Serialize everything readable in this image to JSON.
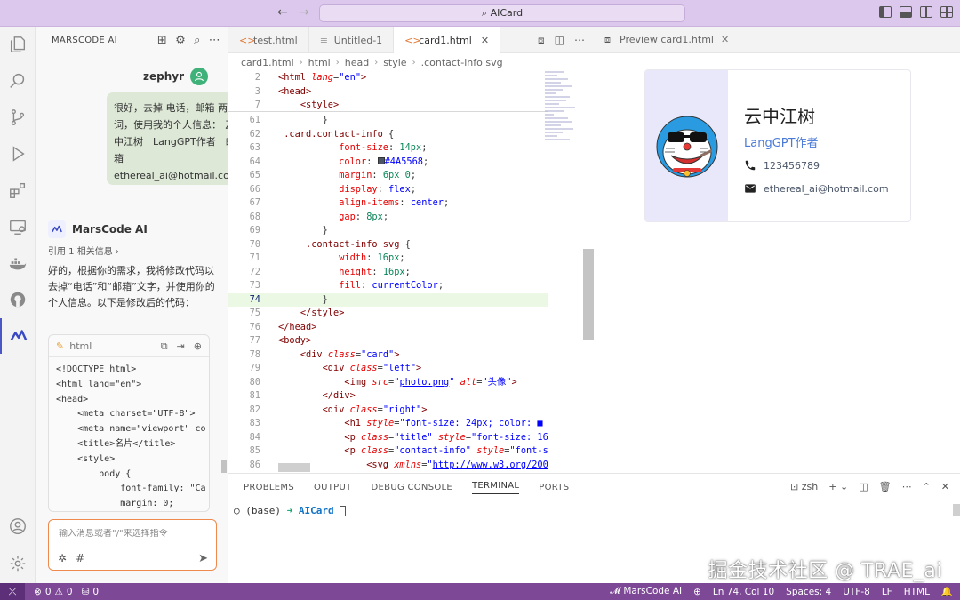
{
  "titlebar": {
    "back": "←",
    "forward": "→",
    "search_text": "AICard"
  },
  "sidepanel": {
    "title": "MARSCODE AI",
    "user_name": "zephyr",
    "user_message": "很好，去掉 电话，邮箱 两个词，使用我的个人信息： 云中江树　LangGPT作者　邮箱 ethereal_ai@hotmail.com",
    "ai_name": "MarsCode AI",
    "reference": "引用 1 相关信息 ›",
    "ai_reply": "好的，根据你的需求，我将修改代码以去掉“电话”和“邮箱”文字，并使用你的个人信息。以下是修改后的代码：",
    "code_lang": "html",
    "code_snippet": "<!DOCTYPE html>\n<html lang=\"en\">\n<head>\n    <meta charset=\"UTF-8\">\n    <meta name=\"viewport\" co\n    <title>名片</title>\n    <style>\n        body {\n            font-family: \"Ca\n            margin: 0;",
    "input_placeholder": "输入消息或者\"/\"来选择指令"
  },
  "editor": {
    "tabs": [
      {
        "label": "test.html",
        "active": false
      },
      {
        "label": "Untitled-1",
        "active": false
      },
      {
        "label": "card1.html",
        "active": true
      }
    ],
    "breadcrumb": [
      "card1.html",
      "html",
      "head",
      "style",
      ".contact-info svg"
    ],
    "current_line": 74
  },
  "preview": {
    "tab_label": "Preview card1.html",
    "name": "云中江树",
    "title": "LangGPT作者",
    "phone": "123456789",
    "email": "ethereal_ai@hotmail.com"
  },
  "bottompanel": {
    "tabs": [
      "PROBLEMS",
      "OUTPUT",
      "DEBUG CONSOLE",
      "TERMINAL",
      "PORTS"
    ],
    "active_tab": "TERMINAL",
    "shell": "zsh",
    "prompt_env": "(base)",
    "prompt_arrow": "➜",
    "prompt_dir": "AICard",
    "watermark": "掘金技术社区 @ TRAE_ai"
  },
  "statusbar": {
    "errors": "0",
    "warnings": "0",
    "ports": "0",
    "marscode": "MarsCode AI",
    "position": "Ln 74, Col 10",
    "spaces": "Spaces: 4",
    "encoding": "UTF-8",
    "eol": "LF",
    "language": "HTML",
    "accent": "#7d4896"
  }
}
